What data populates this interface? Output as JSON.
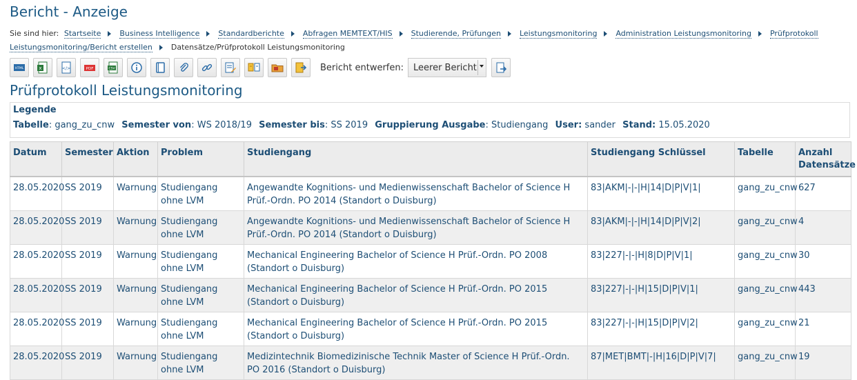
{
  "page": {
    "title": "Bericht - Anzeige"
  },
  "breadcrumb": {
    "prefix": "Sie sind hier:",
    "items": [
      "Startseite",
      "Business Intelligence",
      "Standardberichte",
      "Abfragen MEMTEXT/HIS",
      "Studierende, Prüfungen",
      "Leistungsmonitoring",
      "Administration Leistungsmonitoring",
      "Prüfprotokoll Leistungsmonitoring/Bericht erstellen"
    ],
    "current": "Datensätze/Prüfprotokoll Leistungsmonitoring"
  },
  "toolbar": {
    "icons": [
      "html-export-icon",
      "excel-export-icon",
      "xml-export-icon",
      "pdf-export-icon",
      "csv-export-icon",
      "info-icon",
      "notebook-icon",
      "attachment-icon",
      "link-icon",
      "edit-report-icon",
      "compare-report-icon",
      "folder-icon",
      "export-report-icon"
    ],
    "design_label": "Bericht entwerfen:",
    "design_select_value": "Leerer Bericht",
    "go_icon": "apply-design-icon"
  },
  "report": {
    "title": "Prüfprotokoll Leistungsmonitoring"
  },
  "legend": {
    "heading": "Legende",
    "tabelle_key": "Tabelle",
    "tabelle_value": "gang_zu_cnw",
    "sem_von_key": "Semester von",
    "sem_von_value": "WS 2018/19",
    "sem_bis_key": "Semester bis",
    "sem_bis_value": "SS 2019",
    "gruppierung_key": "Gruppierung Ausgabe",
    "gruppierung_value": "Studiengang",
    "user_key": "User:",
    "user_value": "sander",
    "stand_key": "Stand:",
    "stand_value": "15.05.2020"
  },
  "table": {
    "headers": [
      "Datum",
      "Semester",
      "Aktion",
      "Problem",
      "Studiengang",
      "Studiengang Schlüssel",
      "Tabelle",
      "Anzahl Datensätze"
    ],
    "rows": [
      [
        "28.05.2020",
        "SS 2019",
        "Warnung",
        "Studiengang ohne LVM",
        "Angewandte Kognitions- und Medienwissenschaft Bachelor of Science H Prüf.-Ordn. PO 2014 (Standort o Duisburg)",
        "83|AKM|-|-|H|14|D|P|V|1|",
        "gang_zu_cnw",
        "627"
      ],
      [
        "28.05.2020",
        "SS 2019",
        "Warnung",
        "Studiengang ohne LVM",
        "Angewandte Kognitions- und Medienwissenschaft Bachelor of Science H Prüf.-Ordn. PO 2014 (Standort o Duisburg)",
        "83|AKM|-|-|H|14|D|P|V|2|",
        "gang_zu_cnw",
        "4"
      ],
      [
        "28.05.2020",
        "SS 2019",
        "Warnung",
        "Studiengang ohne LVM",
        "Mechanical Engineering Bachelor of Science H Prüf.-Ordn. PO 2008 (Standort o Duisburg)",
        "83|227|-|-|H|8|D|P|V|1|",
        "gang_zu_cnw",
        "30"
      ],
      [
        "28.05.2020",
        "SS 2019",
        "Warnung",
        "Studiengang ohne LVM",
        "Mechanical Engineering Bachelor of Science H Prüf.-Ordn. PO 2015 (Standort o Duisburg)",
        "83|227|-|-|H|15|D|P|V|1|",
        "gang_zu_cnw",
        "443"
      ],
      [
        "28.05.2020",
        "SS 2019",
        "Warnung",
        "Studiengang ohne LVM",
        "Mechanical Engineering Bachelor of Science H Prüf.-Ordn. PO 2015 (Standort o Duisburg)",
        "83|227|-|-|H|15|D|P|V|2|",
        "gang_zu_cnw",
        "21"
      ],
      [
        "28.05.2020",
        "SS 2019",
        "Warnung",
        "Studiengang ohne LVM",
        "Medizintechnik Biomedizinische Technik Master of Science H Prüf.-Ordn. PO 2016 (Standort o Duisburg)",
        "87|MET|BMT|-|H|16|D|P|V|7|",
        "gang_zu_cnw",
        "19"
      ]
    ]
  }
}
